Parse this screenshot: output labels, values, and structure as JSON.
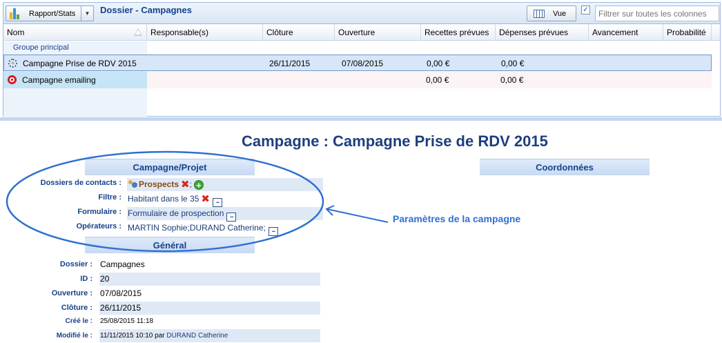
{
  "toolbar": {
    "report_button": "Rapport/Stats",
    "panel_title": "Dossier - Campagnes",
    "view_button": "Vue",
    "filter_placeholder": "Filtrer sur toutes les colonnes",
    "filter_checked": "✓"
  },
  "grid": {
    "columns": [
      "Nom",
      "Responsable(s)",
      "Clôture",
      "Ouverture",
      "Recettes prévues",
      "Dépenses prévues",
      "Avancement",
      "Probabilité"
    ],
    "group": "Groupe principal",
    "rows": [
      {
        "nom": "Campagne Prise de RDV 2015",
        "responsable": "",
        "cloture": "26/11/2015",
        "ouverture": "07/08/2015",
        "recettes": "0,00 €",
        "depenses": "0,00 €",
        "icon": "gear-icon"
      },
      {
        "nom": "Campagne emailing",
        "responsable": "",
        "cloture": "",
        "ouverture": "",
        "recettes": "0,00 €",
        "depenses": "0,00 €",
        "icon": "target-icon"
      }
    ]
  },
  "detail": {
    "title": "Campagne : Campagne Prise de RDV 2015",
    "section_campagne": "Campagne/Projet",
    "section_coordonnees": "Coordonnées",
    "section_general": "Général",
    "campagne_fields": {
      "dossiers_label": "Dossiers de contacts :",
      "dossiers_value": "Prospects",
      "dossiers_sep": ";",
      "filtre_label": "Filtre :",
      "filtre_value": "Habitant dans le 35",
      "formulaire_label": "Formulaire :",
      "formulaire_value": "Formulaire de prospection",
      "operateurs_label": "Opérateurs :",
      "operateurs_value": "MARTIN Sophie;DURAND Catherine;"
    },
    "general_fields": {
      "dossier_label": "Dossier :",
      "dossier_value": "Campagnes",
      "id_label": "ID :",
      "id_value": "20",
      "ouverture_label": "Ouverture :",
      "ouverture_value": "07/08/2015",
      "cloture_label": "Clôture :",
      "cloture_value": "26/11/2015",
      "cree_label": "Créé le :",
      "cree_value": "25/08/2015 11:18",
      "modifie_label": "Modifié le :",
      "modifie_value": "11/11/2015 10:10 par",
      "modifie_by": "DURAND Catherine"
    }
  },
  "annotation": {
    "callout": "Paramètres de la campagne",
    "color": "#2f6fd0"
  },
  "colors": {
    "accent": "#15428b",
    "selection": "#d7e6f8",
    "section_bg": "#dfe9f6"
  }
}
